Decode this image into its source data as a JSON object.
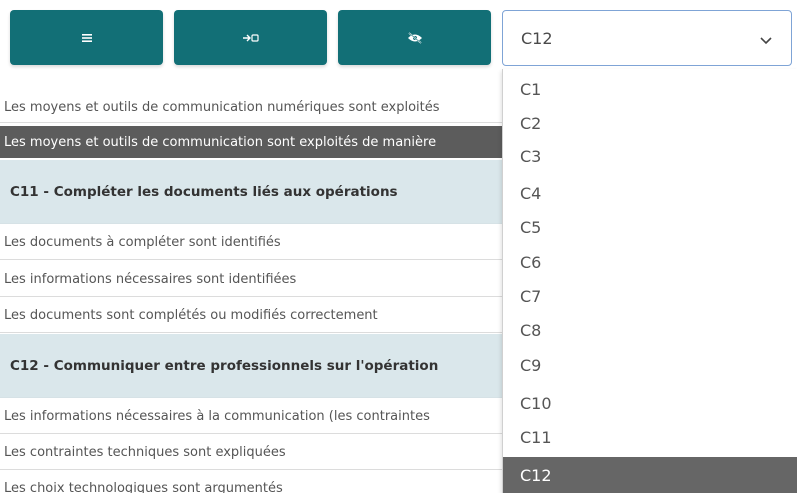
{
  "toolbar": {
    "buttons": [
      {
        "icon": "list-icon"
      },
      {
        "icon": "arrow-right-icon"
      },
      {
        "icon": "eye-off-icon"
      }
    ],
    "color": "#126f76"
  },
  "select": {
    "value": "C12",
    "options": [
      "C1",
      "C2",
      "C3",
      "C4",
      "C5",
      "C6",
      "C7",
      "C8",
      "C9",
      "C10",
      "C11",
      "C12"
    ],
    "selected": "C12"
  },
  "rows": [
    {
      "type": "plain",
      "text": "Les moyens et outils de communication numériques sont exploités"
    },
    {
      "type": "dark",
      "text": "Les moyens et outils de communication sont exploités de manière"
    },
    {
      "type": "section",
      "text": "C11 - Compléter les documents liés aux opérations"
    },
    {
      "type": "plain",
      "text": "Les documents à compléter sont identifiés"
    },
    {
      "type": "plain",
      "text": "Les informations nécessaires sont identifiées"
    },
    {
      "type": "plain",
      "text": "Les documents sont complétés ou modifiés correctement"
    },
    {
      "type": "section",
      "text": "C12 - Communiquer entre professionnels sur l'opération"
    },
    {
      "type": "plain",
      "text": "Les informations nécessaires à la communication (les contraintes"
    },
    {
      "type": "plain",
      "text": "Les contraintes techniques sont expliquées"
    },
    {
      "type": "plain",
      "text": "Les choix technologiques sont argumentés"
    }
  ]
}
